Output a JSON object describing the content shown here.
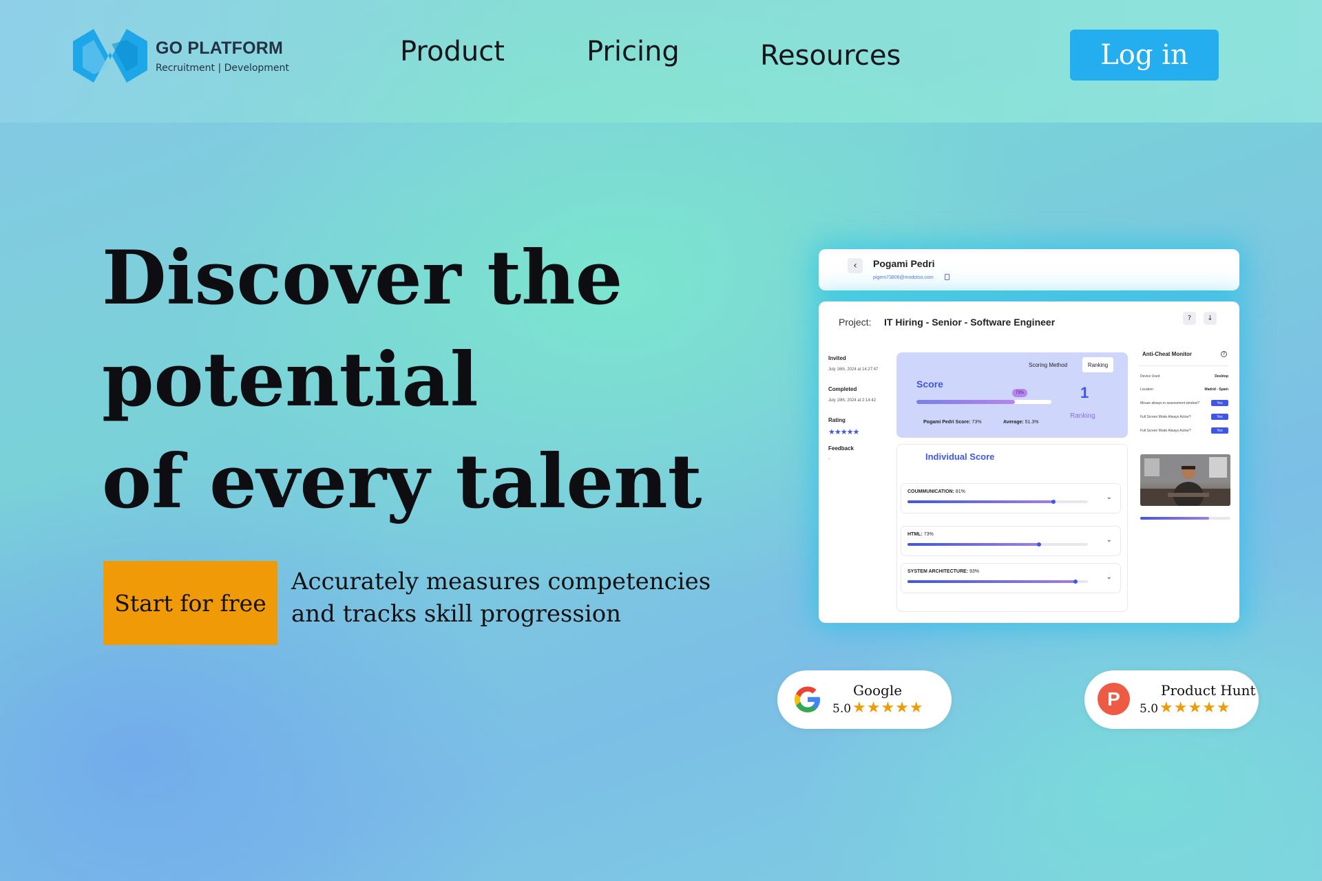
{
  "brand": {
    "name": "GO PLATFORM",
    "tagline": "Recruitment | Development",
    "accent": "#24aef0"
  },
  "nav": {
    "links": [
      "Product",
      "Pricing",
      "Resources"
    ],
    "login_label": "Log in"
  },
  "hero": {
    "headline_lines": [
      "Discover the",
      "potential",
      "of every talent"
    ],
    "cta_label": "Start for free",
    "cta_color": "#ef9a06",
    "subtitle_lines": [
      "Accurately measures competencies",
      "and tracks skill progression"
    ]
  },
  "dashboard": {
    "candidate_name": "Pogami Pedri",
    "candidate_email": "pigem73806@modotso.com",
    "project_label": "Project:",
    "project_name": "IT Hiring - Senior - Software Engineer",
    "meta": {
      "invited_label": "Invited",
      "invited_value": "July 16th, 2024 at 14:27:47",
      "completed_label": "Completed",
      "completed_value": "July 19th, 2024 at 2:14:42",
      "rating_label": "Rating",
      "rating_stars": "★★★★★",
      "feedback_label": "Feedback",
      "feedback_value": "-"
    },
    "score": {
      "scoring_method_label": "Scoring Method",
      "ranking_option": "Ranking",
      "title": "Score",
      "percent_label": "73%",
      "percent": 73,
      "candidate_score_label": "Pogami Pedri Score:",
      "candidate_score_value": "73%",
      "average_label": "Average:",
      "average_value": "51.3%",
      "rank_value": "1",
      "rank_label": "Ranking"
    },
    "individual": {
      "title": "Individual Score",
      "skills": [
        {
          "name": "COUMMUNICATION:",
          "value_label": "81%",
          "percent": 81
        },
        {
          "name": "HTML:",
          "value_label": "73%",
          "percent": 73
        },
        {
          "name": "SYSTEM ARCHITECTURE:",
          "value_label": "93%",
          "percent": 93
        }
      ]
    },
    "anti_cheat": {
      "title": "Anti-Cheat Monitor",
      "rows": [
        {
          "key": "Device Used",
          "value": "Desktop"
        },
        {
          "key": "Location",
          "value": "Madrid - Spain"
        },
        {
          "key": "Mouse always in assessment window?",
          "value": "Yes"
        },
        {
          "key": "Full Screen Mode Always Active?",
          "value": "Yes"
        },
        {
          "key": "Full Screen Mode Always Active?",
          "value": "Yes"
        }
      ],
      "webcam_progress": 76
    }
  },
  "reviews": [
    {
      "platform": "Google",
      "score": "5.0",
      "stars": "★★★★★",
      "icon": "google-g-icon"
    },
    {
      "platform": "Product Hunt",
      "score": "5.0",
      "stars": "★★★★★",
      "icon": "product-hunt-icon",
      "logo_letter": "P"
    }
  ]
}
